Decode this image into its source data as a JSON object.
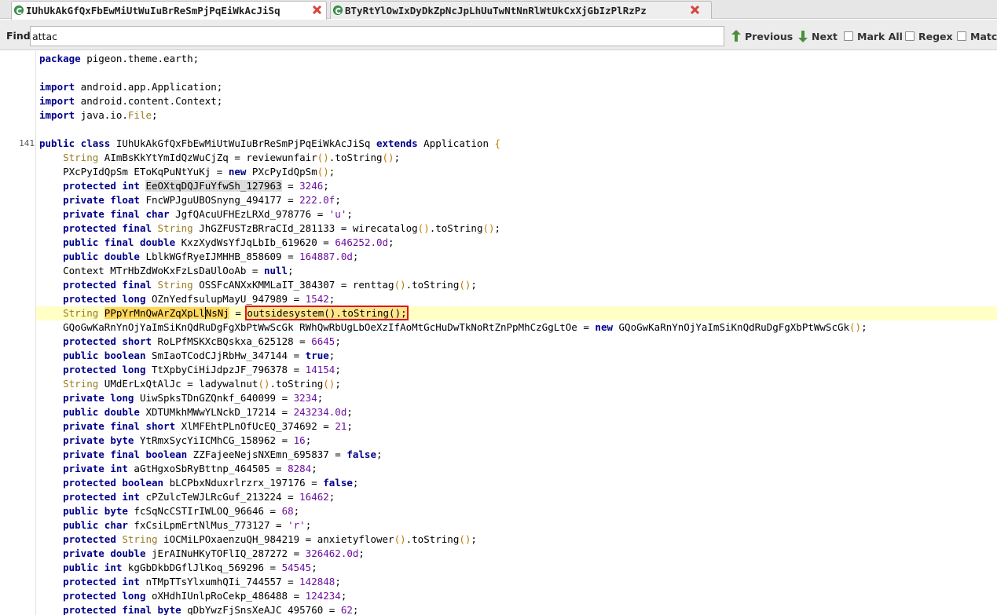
{
  "tabs": [
    {
      "label": "IUhUkAkGfQxFbEwMiUtWuIuBrReSmPjPqEiWkAcJiSq",
      "active": true
    },
    {
      "label": "BTyRtYlOwIxDyDkZpNcJpLhUuTwNtNnRlWtUkCxXjGbIzPlRzPz",
      "active": false
    }
  ],
  "find": {
    "label": "Find:",
    "value": "attac",
    "previous": "Previous",
    "next": "Next",
    "mark_all": "Mark All",
    "regex": "Regex",
    "match": "Match"
  },
  "gutter_numbers": {
    "class_line": "141"
  },
  "code_lines": [
    {
      "tokens": [
        [
          "kw",
          "package"
        ],
        [
          "plain",
          " pigeon.theme.earth;"
        ]
      ]
    },
    {
      "tokens": []
    },
    {
      "tokens": [
        [
          "kw",
          "import"
        ],
        [
          "plain",
          " android.app.Application;"
        ]
      ]
    },
    {
      "tokens": [
        [
          "kw",
          "import"
        ],
        [
          "plain",
          " android.content.Context;"
        ]
      ]
    },
    {
      "tokens": [
        [
          "kw",
          "import"
        ],
        [
          "plain",
          " java.io."
        ],
        [
          "ty",
          "File"
        ],
        [
          "plain",
          ";"
        ]
      ]
    },
    {
      "tokens": []
    },
    {
      "num": "141",
      "tokens": [
        [
          "kw",
          "public class"
        ],
        [
          "plain",
          " IUhUkAkGfQxFbEwMiUtWuIuBrReSmPjPqEiWkAcJiSq "
        ],
        [
          "kw",
          "extends"
        ],
        [
          "plain",
          " Application "
        ],
        [
          "paren",
          "{"
        ]
      ]
    },
    {
      "tokens": [
        [
          "plain",
          "    "
        ],
        [
          "ty",
          "String"
        ],
        [
          "plain",
          " AImBsKkYtYmIdQzWuCjZq = reviewunfair"
        ],
        [
          "paren",
          "()"
        ],
        [
          "plain",
          ".toString"
        ],
        [
          "paren",
          "()"
        ],
        [
          "plain",
          ";"
        ]
      ]
    },
    {
      "tokens": [
        [
          "plain",
          "    PXcPyIdQpSm EToKqPuNtYuKj = "
        ],
        [
          "kw",
          "new"
        ],
        [
          "plain",
          " PXcPyIdQpSm"
        ],
        [
          "paren",
          "()"
        ],
        [
          "plain",
          ";"
        ]
      ]
    },
    {
      "tokens": [
        [
          "plain",
          "    "
        ],
        [
          "kw",
          "protected int"
        ],
        [
          "plain",
          " "
        ],
        [
          "selgrey",
          "EeOXtqDQJFuYfwSh_127963"
        ],
        [
          "plain",
          " = "
        ],
        [
          "num",
          "3246"
        ],
        [
          "plain",
          ";"
        ]
      ]
    },
    {
      "tokens": [
        [
          "plain",
          "    "
        ],
        [
          "kw",
          "private float"
        ],
        [
          "plain",
          " FncWPJguUBOSnyng_494177 = "
        ],
        [
          "num",
          "222.0f"
        ],
        [
          "plain",
          ";"
        ]
      ]
    },
    {
      "tokens": [
        [
          "plain",
          "    "
        ],
        [
          "kw",
          "private final char"
        ],
        [
          "plain",
          " JgfQAcuUFHEzLRXd_978776 = "
        ],
        [
          "str",
          "'u'"
        ],
        [
          "plain",
          ";"
        ]
      ]
    },
    {
      "tokens": [
        [
          "plain",
          "    "
        ],
        [
          "kw",
          "protected final"
        ],
        [
          "plain",
          " "
        ],
        [
          "ty",
          "String"
        ],
        [
          "plain",
          " JhGZFUSTzBRraCId_281133 = wirecatalog"
        ],
        [
          "paren",
          "()"
        ],
        [
          "plain",
          ".toString"
        ],
        [
          "paren",
          "()"
        ],
        [
          "plain",
          ";"
        ]
      ]
    },
    {
      "tokens": [
        [
          "plain",
          "    "
        ],
        [
          "kw",
          "public final double"
        ],
        [
          "plain",
          " KxzXydWsYfJqLbIb_619620 = "
        ],
        [
          "num",
          "646252.0d"
        ],
        [
          "plain",
          ";"
        ]
      ]
    },
    {
      "tokens": [
        [
          "plain",
          "    "
        ],
        [
          "kw",
          "public double"
        ],
        [
          "plain",
          " LblkWGfRyeIJMHHB_858609 = "
        ],
        [
          "num",
          "164887.0d"
        ],
        [
          "plain",
          ";"
        ]
      ]
    },
    {
      "tokens": [
        [
          "plain",
          "    Context MTrHbZdWoKxFzLsDaUlOoAb = "
        ],
        [
          "kw",
          "null"
        ],
        [
          "plain",
          ";"
        ]
      ]
    },
    {
      "tokens": [
        [
          "plain",
          "    "
        ],
        [
          "kw",
          "protected final"
        ],
        [
          "plain",
          " "
        ],
        [
          "ty",
          "String"
        ],
        [
          "plain",
          " OSSFcANXxKMMLaIT_384307 = renttag"
        ],
        [
          "paren",
          "()"
        ],
        [
          "plain",
          ".toString"
        ],
        [
          "paren",
          "()"
        ],
        [
          "plain",
          ";"
        ]
      ]
    },
    {
      "tokens": [
        [
          "plain",
          "    "
        ],
        [
          "kw",
          "protected long"
        ],
        [
          "plain",
          " OZnYedfsulupMayU_947989 = "
        ],
        [
          "num",
          "1542"
        ],
        [
          "plain",
          ";"
        ]
      ]
    },
    {
      "highlight": true,
      "tokens": [
        [
          "plain",
          "    "
        ],
        [
          "ty",
          "String"
        ],
        [
          "plain",
          " "
        ],
        [
          "selyellow",
          "PPpYrMnQwArZqXpLl"
        ],
        [
          "cursor",
          ""
        ],
        [
          "selyellow",
          "NsNj"
        ],
        [
          "plain",
          " = "
        ],
        [
          "redbox",
          "outsidesystem().toString();"
        ]
      ]
    },
    {
      "tokens": [
        [
          "plain",
          "    GQoGwKaRnYnOjYaImSiKnQdRuDgFgXbPtWwScGk RWhQwRbUgLbOeXzIfAoMtGcHuDwTkNoRtZnPpMhCzGgLtOe = "
        ],
        [
          "kw",
          "new"
        ],
        [
          "plain",
          " GQoGwKaRnYnOjYaImSiKnQdRuDgFgXbPtWwScGk"
        ],
        [
          "paren",
          "()"
        ],
        [
          "plain",
          ";"
        ]
      ]
    },
    {
      "tokens": [
        [
          "plain",
          "    "
        ],
        [
          "kw",
          "protected short"
        ],
        [
          "plain",
          " RoLPfMSKXcBQskxa_625128 = "
        ],
        [
          "num",
          "6645"
        ],
        [
          "plain",
          ";"
        ]
      ]
    },
    {
      "tokens": [
        [
          "plain",
          "    "
        ],
        [
          "kw",
          "public boolean"
        ],
        [
          "plain",
          " SmIaoTCodCJjRbHw_347144 = "
        ],
        [
          "kw",
          "true"
        ],
        [
          "plain",
          ";"
        ]
      ]
    },
    {
      "tokens": [
        [
          "plain",
          "    "
        ],
        [
          "kw",
          "protected long"
        ],
        [
          "plain",
          " TtXpbyCiHiJdpzJF_796378 = "
        ],
        [
          "num",
          "14154"
        ],
        [
          "plain",
          ";"
        ]
      ]
    },
    {
      "tokens": [
        [
          "plain",
          "    "
        ],
        [
          "ty",
          "String"
        ],
        [
          "plain",
          " UMdErLxQtAlJc = ladywalnut"
        ],
        [
          "paren",
          "()"
        ],
        [
          "plain",
          ".toString"
        ],
        [
          "paren",
          "()"
        ],
        [
          "plain",
          ";"
        ]
      ]
    },
    {
      "tokens": [
        [
          "plain",
          "    "
        ],
        [
          "kw",
          "private long"
        ],
        [
          "plain",
          " UiwSpksTDnGZQnkf_640099 = "
        ],
        [
          "num",
          "3234"
        ],
        [
          "plain",
          ";"
        ]
      ]
    },
    {
      "tokens": [
        [
          "plain",
          "    "
        ],
        [
          "kw",
          "public double"
        ],
        [
          "plain",
          " XDTUMkhMWwYLNckD_17214 = "
        ],
        [
          "num",
          "243234.0d"
        ],
        [
          "plain",
          ";"
        ]
      ]
    },
    {
      "tokens": [
        [
          "plain",
          "    "
        ],
        [
          "kw",
          "private final short"
        ],
        [
          "plain",
          " XlMFEhtPLnOfUcEQ_374692 = "
        ],
        [
          "num",
          "21"
        ],
        [
          "plain",
          ";"
        ]
      ]
    },
    {
      "tokens": [
        [
          "plain",
          "    "
        ],
        [
          "kw",
          "private byte"
        ],
        [
          "plain",
          " YtRmxSycYiICMhCG_158962 = "
        ],
        [
          "num",
          "16"
        ],
        [
          "plain",
          ";"
        ]
      ]
    },
    {
      "tokens": [
        [
          "plain",
          "    "
        ],
        [
          "kw",
          "private final boolean"
        ],
        [
          "plain",
          " ZZFajeeNejsNXEmn_695837 = "
        ],
        [
          "kw",
          "false"
        ],
        [
          "plain",
          ";"
        ]
      ]
    },
    {
      "tokens": [
        [
          "plain",
          "    "
        ],
        [
          "kw",
          "private int"
        ],
        [
          "plain",
          " aGtHgxoSbRyBttnp_464505 = "
        ],
        [
          "num",
          "8284"
        ],
        [
          "plain",
          ";"
        ]
      ]
    },
    {
      "tokens": [
        [
          "plain",
          "    "
        ],
        [
          "kw",
          "protected boolean"
        ],
        [
          "plain",
          " bLCPbxNduxrlrzrx_197176 = "
        ],
        [
          "kw",
          "false"
        ],
        [
          "plain",
          ";"
        ]
      ]
    },
    {
      "tokens": [
        [
          "plain",
          "    "
        ],
        [
          "kw",
          "protected int"
        ],
        [
          "plain",
          " cPZulcTeWJLRcGuf_213224 = "
        ],
        [
          "num",
          "16462"
        ],
        [
          "plain",
          ";"
        ]
      ]
    },
    {
      "tokens": [
        [
          "plain",
          "    "
        ],
        [
          "kw",
          "public byte"
        ],
        [
          "plain",
          " fcSqNcCSTIrIWLOQ_96646 = "
        ],
        [
          "num",
          "68"
        ],
        [
          "plain",
          ";"
        ]
      ]
    },
    {
      "tokens": [
        [
          "plain",
          "    "
        ],
        [
          "kw",
          "public char"
        ],
        [
          "plain",
          " fxCsiLpmErtNlMus_773127 = "
        ],
        [
          "str",
          "'r'"
        ],
        [
          "plain",
          ";"
        ]
      ]
    },
    {
      "tokens": [
        [
          "plain",
          "    "
        ],
        [
          "kw",
          "protected"
        ],
        [
          "plain",
          " "
        ],
        [
          "ty",
          "String"
        ],
        [
          "plain",
          " iOCMiLPOxaenzuQH_984219 = anxietyflower"
        ],
        [
          "paren",
          "()"
        ],
        [
          "plain",
          ".toString"
        ],
        [
          "paren",
          "()"
        ],
        [
          "plain",
          ";"
        ]
      ]
    },
    {
      "tokens": [
        [
          "plain",
          "    "
        ],
        [
          "kw",
          "private double"
        ],
        [
          "plain",
          " jErAINuHKyTOFlIQ_287272 = "
        ],
        [
          "num",
          "326462.0d"
        ],
        [
          "plain",
          ";"
        ]
      ]
    },
    {
      "tokens": [
        [
          "plain",
          "    "
        ],
        [
          "kw",
          "public int"
        ],
        [
          "plain",
          " kgGbDkbDGflJlKoq_569296 = "
        ],
        [
          "num",
          "54545"
        ],
        [
          "plain",
          ";"
        ]
      ]
    },
    {
      "tokens": [
        [
          "plain",
          "    "
        ],
        [
          "kw",
          "protected int"
        ],
        [
          "plain",
          " nTMpTTsYlxumhQIi_744557 = "
        ],
        [
          "num",
          "142848"
        ],
        [
          "plain",
          ";"
        ]
      ]
    },
    {
      "tokens": [
        [
          "plain",
          "    "
        ],
        [
          "kw",
          "protected long"
        ],
        [
          "plain",
          " oXHdhIUnlpRoCekp_486488 = "
        ],
        [
          "num",
          "124234"
        ],
        [
          "plain",
          ";"
        ]
      ]
    },
    {
      "tokens": [
        [
          "plain",
          "    "
        ],
        [
          "kw",
          "protected final byte"
        ],
        [
          "plain",
          " qDbYwzFjSnsXeAJC_495760 = "
        ],
        [
          "num",
          "62"
        ],
        [
          "plain",
          ";"
        ]
      ]
    }
  ],
  "colors": {
    "keyword": "#00008b",
    "type": "#9b7a22",
    "number": "#6b0f9e",
    "highlight_line": "#ffffc6",
    "search_match": "#ffd75a",
    "red_box": "#e0141e"
  },
  "icons": {
    "tab_icon": "class-icon",
    "tab_close": "close-icon",
    "previous": "arrow-up-icon",
    "next": "arrow-down-icon"
  }
}
